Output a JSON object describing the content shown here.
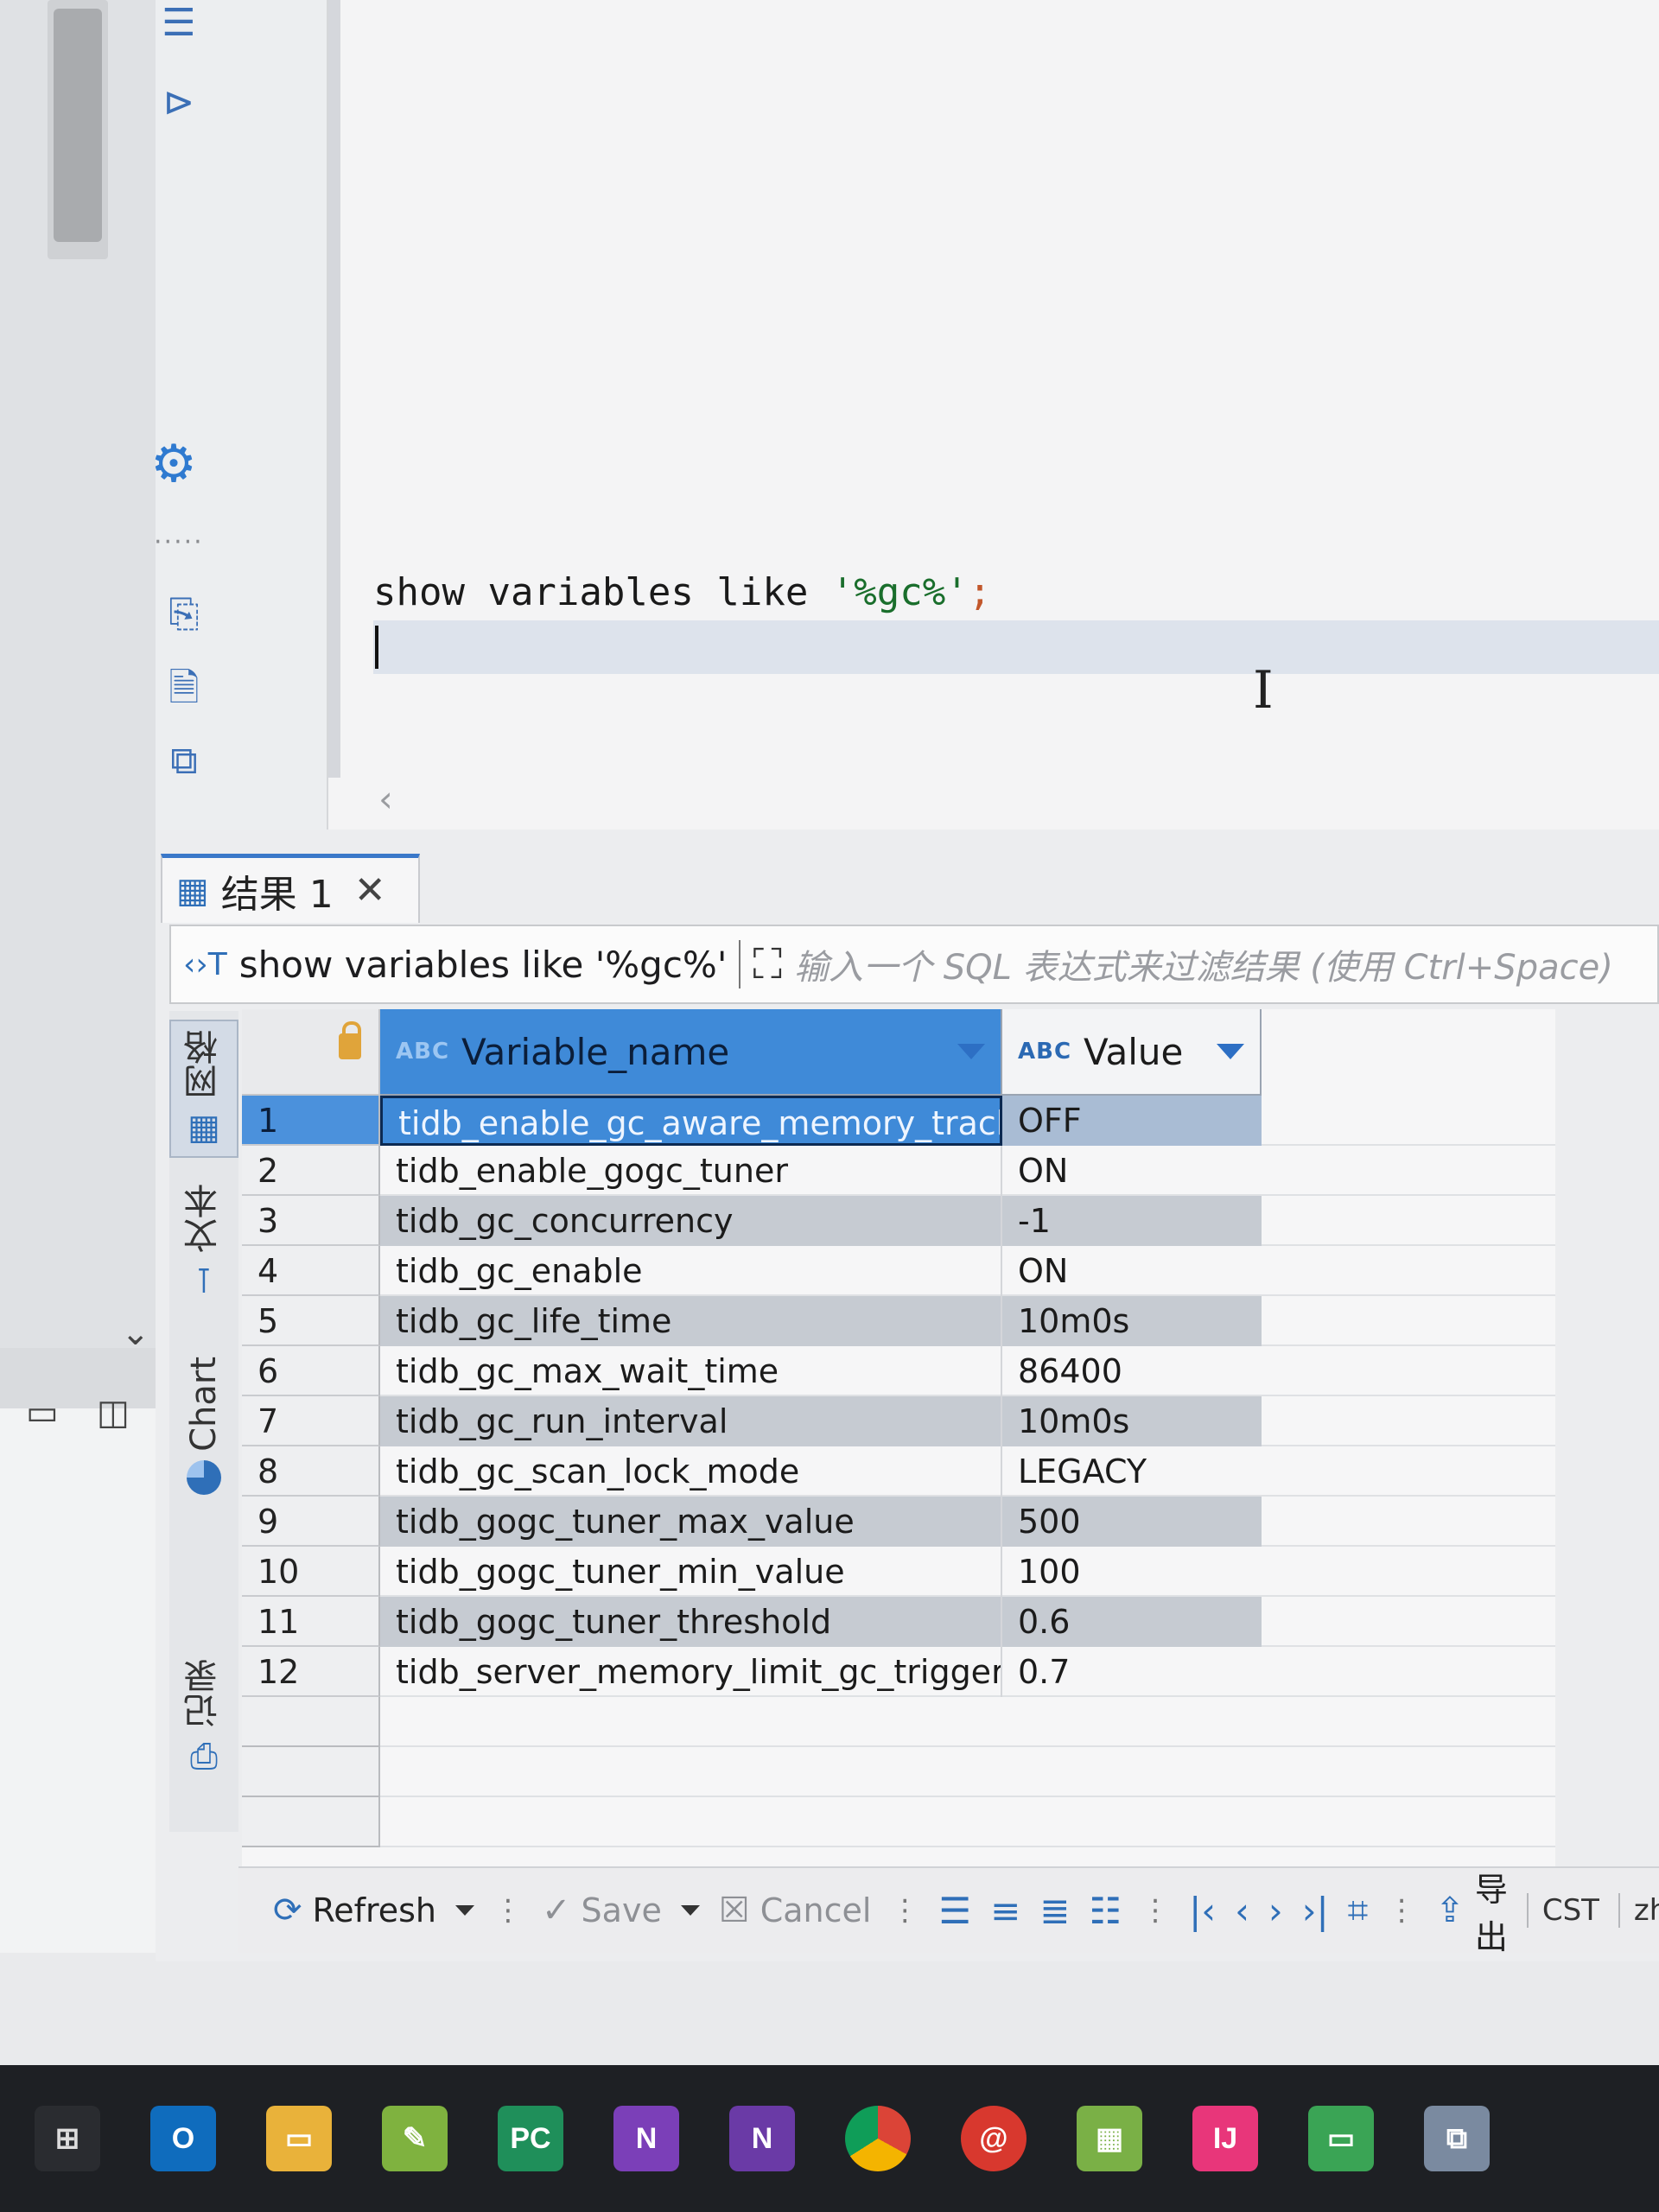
{
  "editor": {
    "sql_keyword_part": "show variables like ",
    "sql_string_part": "'%gc%'",
    "sql_terminator": ";"
  },
  "results": {
    "tab_label": "结果 1",
    "filter_query": "show variables like '%gc%'",
    "filter_placeholder": "输入一个 SQL 表达式来过滤结果 (使用 Ctrl+Space)",
    "side_tabs": [
      "网格",
      "文本",
      "Chart",
      "记录"
    ],
    "columns": [
      {
        "type_badge": "ABC",
        "label": "Variable_name"
      },
      {
        "type_badge": "ABC",
        "label": "Value"
      }
    ],
    "rows": [
      {
        "num": "1",
        "name": "tidb_enable_gc_aware_memory_track",
        "value": "OFF"
      },
      {
        "num": "2",
        "name": "tidb_enable_gogc_tuner",
        "value": "ON"
      },
      {
        "num": "3",
        "name": "tidb_gc_concurrency",
        "value": "-1"
      },
      {
        "num": "4",
        "name": "tidb_gc_enable",
        "value": "ON"
      },
      {
        "num": "5",
        "name": "tidb_gc_life_time",
        "value": "10m0s"
      },
      {
        "num": "6",
        "name": "tidb_gc_max_wait_time",
        "value": "86400"
      },
      {
        "num": "7",
        "name": "tidb_gc_run_interval",
        "value": "10m0s"
      },
      {
        "num": "8",
        "name": "tidb_gc_scan_lock_mode",
        "value": "LEGACY"
      },
      {
        "num": "9",
        "name": "tidb_gogc_tuner_max_value",
        "value": "500"
      },
      {
        "num": "10",
        "name": "tidb_gogc_tuner_min_value",
        "value": "100"
      },
      {
        "num": "11",
        "name": "tidb_gogc_tuner_threshold",
        "value": "0.6"
      },
      {
        "num": "12",
        "name": "tidb_server_memory_limit_gc_trigger",
        "value": "0.7"
      }
    ],
    "bottom_bar": {
      "refresh": "Refresh",
      "save": "Save",
      "cancel": "Cancel",
      "export": "导出",
      "timezone": "CST",
      "locale": "zh"
    }
  },
  "colors": {
    "accent": "#3f8ad8",
    "selection_border": "#0c2a52",
    "alt_row": "#c6cbd2",
    "taskbar": "#1e2024"
  },
  "taskbar_icons": [
    "task-view-icon",
    "outlook-icon",
    "file-explorer-icon",
    "notepad-icon",
    "pycharm-icon",
    "onenote-icon",
    "onenote-2-icon",
    "chrome-icon",
    "swirl-app-icon",
    "calendar-app-icon",
    "intellij-icon",
    "screen-app-icon",
    "network-app-icon"
  ]
}
